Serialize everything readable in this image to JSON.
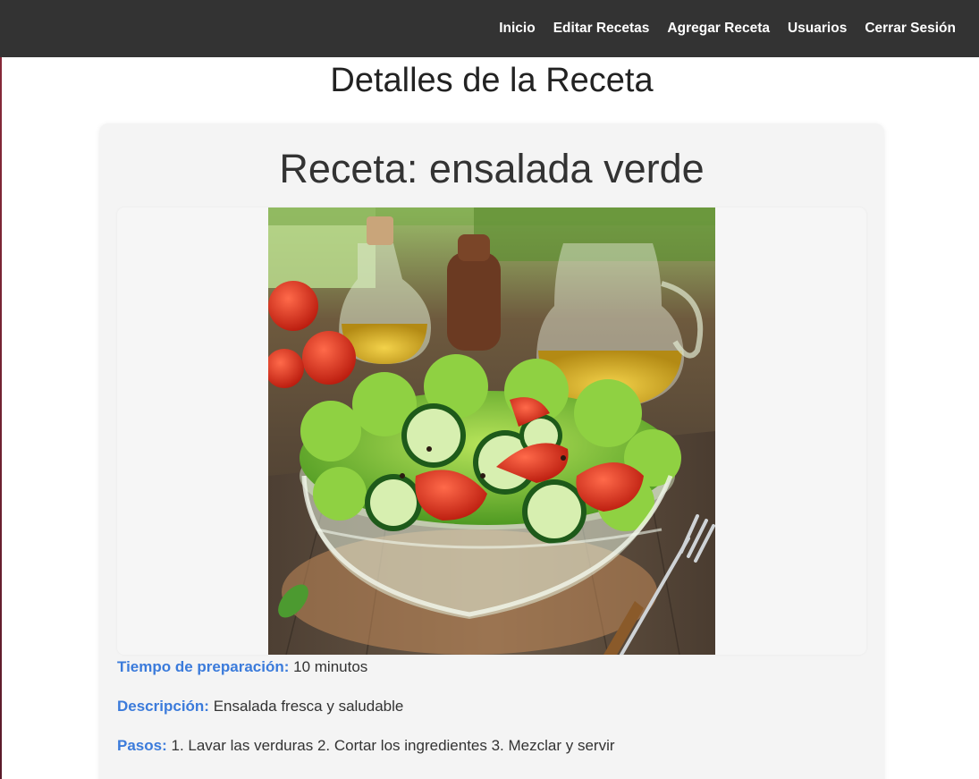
{
  "nav": {
    "items": [
      {
        "label": "Inicio"
      },
      {
        "label": "Editar Recetas"
      },
      {
        "label": "Agregar Receta"
      },
      {
        "label": "Usuarios"
      },
      {
        "label": "Cerrar Sesión"
      }
    ]
  },
  "page": {
    "title": "Detalles de la Receta"
  },
  "recipe": {
    "title": "Receta: ensalada verde",
    "image_alt": "salad-photo",
    "prep_time_label": "Tiempo de preparación:",
    "prep_time_value": "10 minutos",
    "description_label": "Descripción:",
    "description_value": "Ensalada fresca y saludable",
    "steps_label": "Pasos:",
    "steps_value": "1. Lavar las verduras 2. Cortar los ingredientes 3. Mezclar y servir"
  },
  "colors": {
    "navbar_bg": "#333333",
    "label_accent": "#3b7bdb",
    "card_bg": "#f4f4f4"
  }
}
